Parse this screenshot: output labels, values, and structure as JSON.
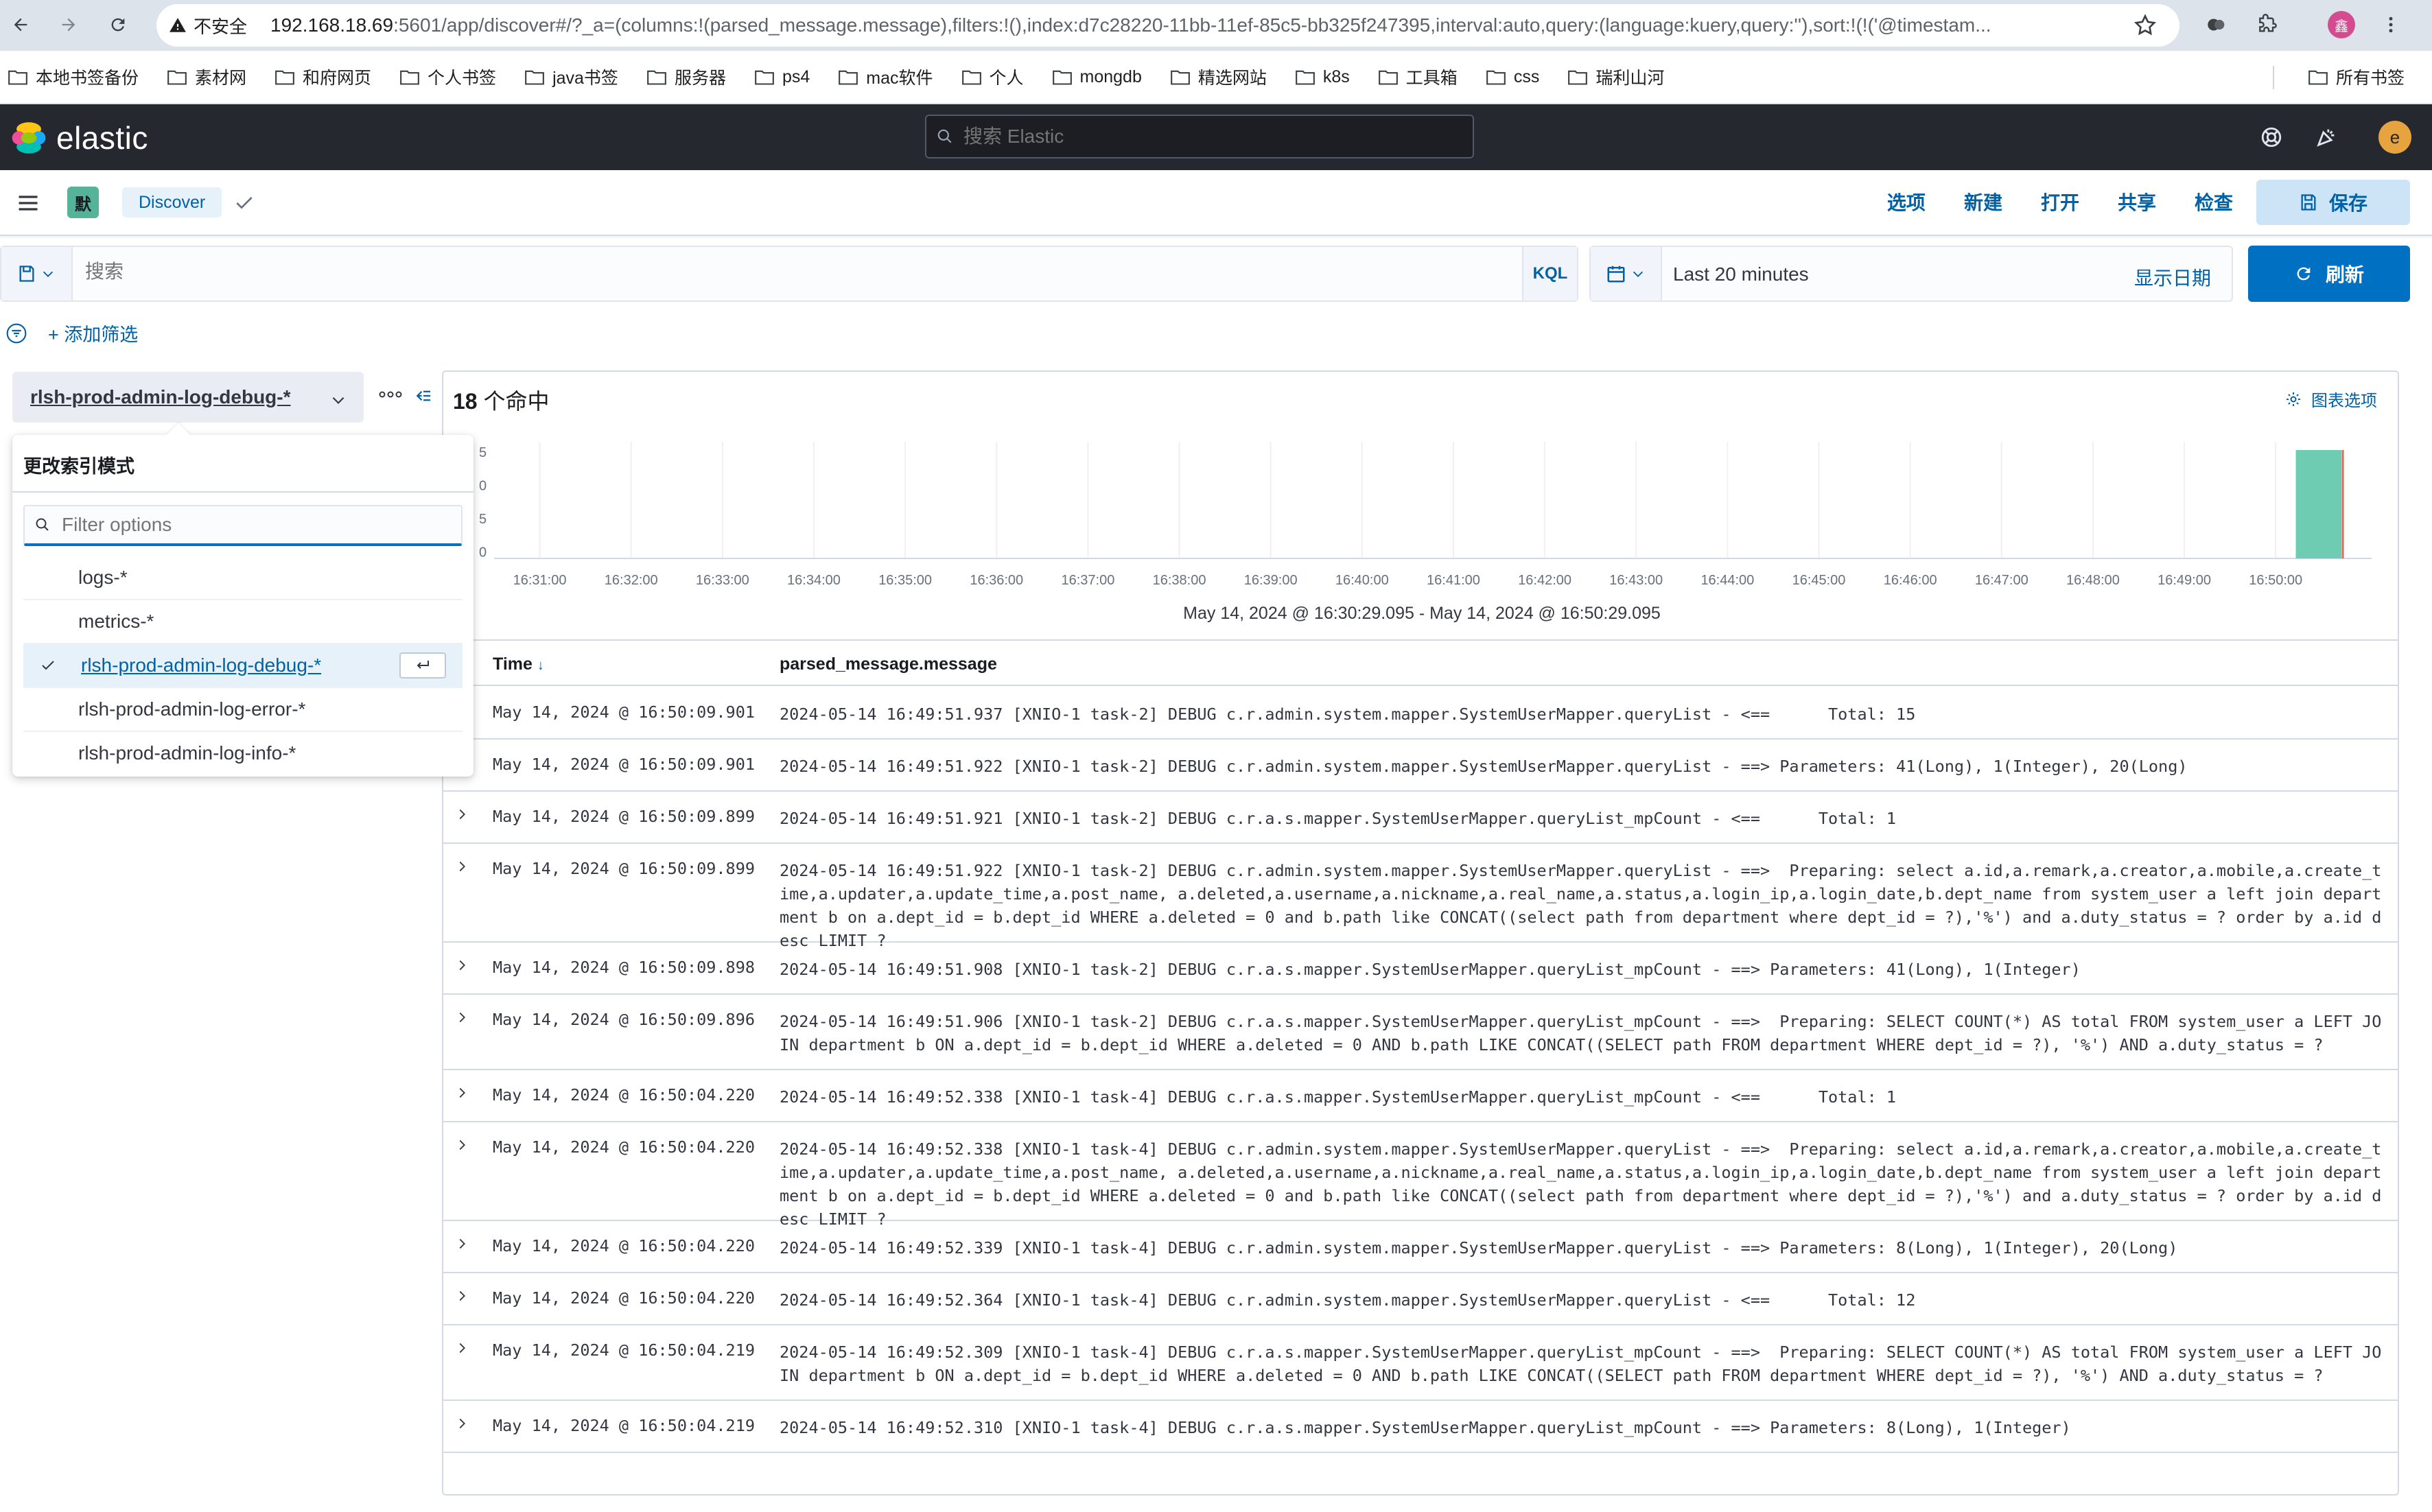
{
  "browser": {
    "secure_label": "不安全",
    "url_host": "192.168.18.69",
    "url_rest": ":5601/app/discover#/?_a=(columns:!(parsed_message.message),filters:!(),index:d7c28220-11bb-11ef-85c5-bb325f247395,interval:auto,query:(language:kuery,query:''),sort:!(!('@timestam...",
    "profile_initial": "鑫",
    "bookmarks": [
      "本地书签备份",
      "素材网",
      "和府网页",
      "个人书签",
      "java书签",
      "服务器",
      "ps4",
      "mac软件",
      "个人",
      "mongdb",
      "精选网站",
      "k8s",
      "工具箱",
      "css",
      "瑞利山河"
    ],
    "all_bookmarks": "所有书签"
  },
  "header": {
    "logo_text": "elastic",
    "search_placeholder": "搜索 Elastic",
    "avatar_initial": "e"
  },
  "subheader": {
    "space_initial": "默",
    "breadcrumb": "Discover",
    "links": [
      "选项",
      "新建",
      "打开",
      "共享",
      "检查"
    ],
    "save_label": "保存"
  },
  "query": {
    "placeholder": "搜索",
    "language": "KQL",
    "time_range": "Last 20 minutes",
    "show_dates": "显示日期",
    "refresh": "刷新",
    "add_filter": "+ 添加筛选"
  },
  "sidebar": {
    "index_pattern": "rlsh-prod-admin-log-debug-*",
    "popover_title": "更改索引模式",
    "filter_placeholder": "Filter options",
    "options": [
      {
        "label": "logs-*",
        "selected": false
      },
      {
        "label": "metrics-*",
        "selected": false
      },
      {
        "label": "rlsh-prod-admin-log-debug-*",
        "selected": true
      },
      {
        "label": "rlsh-prod-admin-log-error-*",
        "selected": false
      },
      {
        "label": "rlsh-prod-admin-log-info-*",
        "selected": false
      }
    ]
  },
  "results": {
    "hits_count": "18",
    "hits_label": " 个命中",
    "chart_options": "图表选项",
    "time_range_text": "May 14, 2024 @ 16:30:29.095 - May 14, 2024 @ 16:50:29.095",
    "col_time": "Time",
    "col_message": "parsed_message.message"
  },
  "chart_data": {
    "type": "bar",
    "x": [
      "16:31:00",
      "16:32:00",
      "16:33:00",
      "16:34:00",
      "16:35:00",
      "16:36:00",
      "16:37:00",
      "16:38:00",
      "16:39:00",
      "16:40:00",
      "16:41:00",
      "16:42:00",
      "16:43:00",
      "16:44:00",
      "16:45:00",
      "16:46:00",
      "16:47:00",
      "16:48:00",
      "16:49:00",
      "16:50:00"
    ],
    "values": [
      0,
      0,
      0,
      0,
      0,
      0,
      0,
      0,
      0,
      0,
      0,
      0,
      0,
      0,
      0,
      0,
      0,
      0,
      0,
      18
    ],
    "y_ticks": [
      "5",
      "0",
      "5",
      "0"
    ],
    "bar_color": "#6dccb1",
    "grid": true
  },
  "rows": [
    {
      "time": "May 14, 2024 @ 16:50:09.901",
      "msg": "2024-05-14 16:49:51.937 [XNIO-1 task-2] DEBUG c.r.admin.system.mapper.SystemUserMapper.queryList - <==      Total: 15"
    },
    {
      "time": "May 14, 2024 @ 16:50:09.901",
      "msg": "2024-05-14 16:49:51.922 [XNIO-1 task-2] DEBUG c.r.admin.system.mapper.SystemUserMapper.queryList - ==> Parameters: 41(Long), 1(Integer), 20(Long)"
    },
    {
      "time": "May 14, 2024 @ 16:50:09.899",
      "msg": "2024-05-14 16:49:51.921 [XNIO-1 task-2] DEBUG c.r.a.s.mapper.SystemUserMapper.queryList_mpCount - <==      Total: 1"
    },
    {
      "time": "May 14, 2024 @ 16:50:09.899",
      "msg": "2024-05-14 16:49:51.922 [XNIO-1 task-2] DEBUG c.r.admin.system.mapper.SystemUserMapper.queryList - ==>  Preparing: select a.id,a.remark,a.creator,a.mobile,a.create_time,a.updater,a.update_time,a.post_name, a.deleted,a.username,a.nickname,a.real_name,a.status,a.login_ip,a.login_date,b.dept_name from system_user a left join department b on a.dept_id = b.dept_id WHERE a.deleted = 0 and b.path like CONCAT((select path from department where dept_id = ?),'%') and a.duty_status = ? order by a.id desc LIMIT ?"
    },
    {
      "time": "May 14, 2024 @ 16:50:09.898",
      "msg": "2024-05-14 16:49:51.908 [XNIO-1 task-2] DEBUG c.r.a.s.mapper.SystemUserMapper.queryList_mpCount - ==> Parameters: 41(Long), 1(Integer)"
    },
    {
      "time": "May 14, 2024 @ 16:50:09.896",
      "msg": "2024-05-14 16:49:51.906 [XNIO-1 task-2] DEBUG c.r.a.s.mapper.SystemUserMapper.queryList_mpCount - ==>  Preparing: SELECT COUNT(*) AS total FROM system_user a LEFT JOIN department b ON a.dept_id = b.dept_id WHERE a.deleted = 0 AND b.path LIKE CONCAT((SELECT path FROM department WHERE dept_id = ?), '%') AND a.duty_status = ?"
    },
    {
      "time": "May 14, 2024 @ 16:50:04.220",
      "msg": "2024-05-14 16:49:52.338 [XNIO-1 task-4] DEBUG c.r.a.s.mapper.SystemUserMapper.queryList_mpCount - <==      Total: 1"
    },
    {
      "time": "May 14, 2024 @ 16:50:04.220",
      "msg": "2024-05-14 16:49:52.338 [XNIO-1 task-4] DEBUG c.r.admin.system.mapper.SystemUserMapper.queryList - ==>  Preparing: select a.id,a.remark,a.creator,a.mobile,a.create_time,a.updater,a.update_time,a.post_name, a.deleted,a.username,a.nickname,a.real_name,a.status,a.login_ip,a.login_date,b.dept_name from system_user a left join department b on a.dept_id = b.dept_id WHERE a.deleted = 0 and b.path like CONCAT((select path from department where dept_id = ?),'%') and a.duty_status = ? order by a.id desc LIMIT ?"
    },
    {
      "time": "May 14, 2024 @ 16:50:04.220",
      "msg": "2024-05-14 16:49:52.339 [XNIO-1 task-4] DEBUG c.r.admin.system.mapper.SystemUserMapper.queryList - ==> Parameters: 8(Long), 1(Integer), 20(Long)"
    },
    {
      "time": "May 14, 2024 @ 16:50:04.220",
      "msg": "2024-05-14 16:49:52.364 [XNIO-1 task-4] DEBUG c.r.admin.system.mapper.SystemUserMapper.queryList - <==      Total: 12"
    },
    {
      "time": "May 14, 2024 @ 16:50:04.219",
      "msg": "2024-05-14 16:49:52.309 [XNIO-1 task-4] DEBUG c.r.a.s.mapper.SystemUserMapper.queryList_mpCount - ==>  Preparing: SELECT COUNT(*) AS total FROM system_user a LEFT JOIN department b ON a.dept_id = b.dept_id WHERE a.deleted = 0 AND b.path LIKE CONCAT((SELECT path FROM department WHERE dept_id = ?), '%') AND a.duty_status = ?"
    },
    {
      "time": "May 14, 2024 @ 16:50:04.219",
      "msg": "2024-05-14 16:49:52.310 [XNIO-1 task-4] DEBUG c.r.a.s.mapper.SystemUserMapper.queryList_mpCount - ==> Parameters: 8(Long), 1(Integer)"
    }
  ]
}
